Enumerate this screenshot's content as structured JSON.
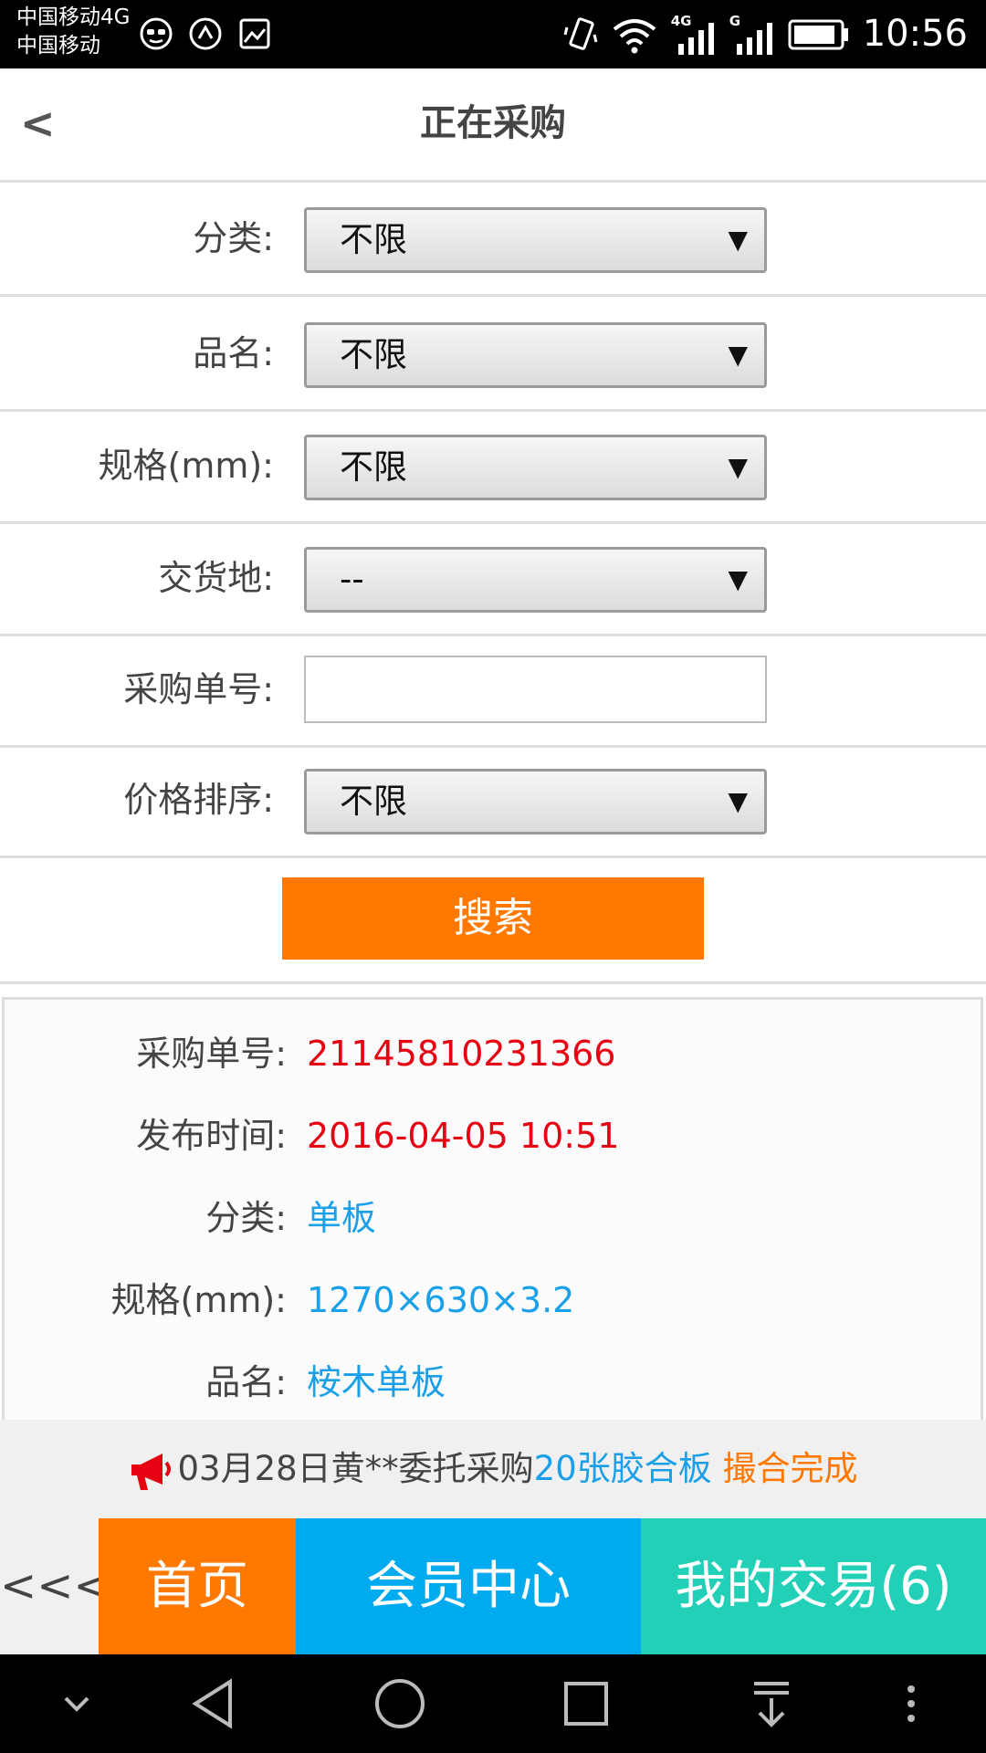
{
  "status_bar": {
    "carrier_line1": "中国移动4G",
    "carrier_line2": "中国移动",
    "network_4g": "4G",
    "network_g": "G",
    "time": "10:56"
  },
  "header": {
    "back_label": "<",
    "title": "正在采购"
  },
  "filters": {
    "category": {
      "label": "分类:",
      "value": "不限"
    },
    "product_name": {
      "label": "品名:",
      "value": "不限"
    },
    "spec": {
      "label": "规格(mm):",
      "value": "不限"
    },
    "delivery_place": {
      "label": "交货地:",
      "value": "--"
    },
    "order_number": {
      "label": "采购单号:",
      "value": ""
    },
    "price_sort": {
      "label": "价格排序:",
      "value": "不限"
    },
    "search_label": "搜索"
  },
  "result": {
    "order_number": {
      "label": "采购单号:",
      "value": "21145810231366"
    },
    "publish_time": {
      "label": "发布时间:",
      "value": "2016-04-05 10:51"
    },
    "category": {
      "label": "分类:",
      "value": "单板"
    },
    "spec": {
      "label": "规格(mm):",
      "value": "1270×630×3.2"
    },
    "product_name": {
      "label": "品名:",
      "value": "桉木单板"
    }
  },
  "notice": {
    "prefix": "03月28日黄**委托采购",
    "item": "20张胶合板",
    "status": "撮合完成"
  },
  "bottom_nav": {
    "back": "<<<",
    "home": "首页",
    "member": "会员中心",
    "trade": "我的交易(6)"
  },
  "colors": {
    "accent_orange": "#ff7800",
    "accent_blue": "#00aaee",
    "accent_teal": "#22d0b8",
    "value_red": "#e60012",
    "value_blue": "#1aa0e8"
  }
}
